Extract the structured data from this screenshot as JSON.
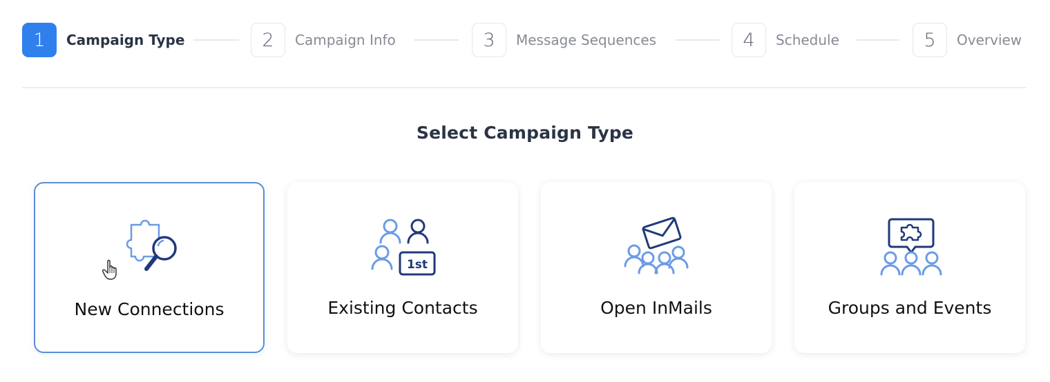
{
  "stepper": {
    "steps": [
      {
        "number": "1",
        "label": "Campaign Type",
        "active": true
      },
      {
        "number": "2",
        "label": "Campaign Info",
        "active": false
      },
      {
        "number": "3",
        "label": "Message Sequences",
        "active": false
      },
      {
        "number": "4",
        "label": "Schedule",
        "active": false
      },
      {
        "number": "5",
        "label": "Overview",
        "active": false
      }
    ]
  },
  "main": {
    "title": "Select Campaign Type",
    "cards": [
      {
        "label": "New Connections",
        "icon": "puzzle-search-icon",
        "selected": true
      },
      {
        "label": "Existing Contacts",
        "icon": "first-degree-contacts-icon",
        "selected": false
      },
      {
        "label": "Open InMails",
        "icon": "group-envelope-icon",
        "selected": false
      },
      {
        "label": "Groups and Events",
        "icon": "group-chat-puzzle-icon",
        "selected": false
      }
    ]
  },
  "colors": {
    "accent": "#2f80ed",
    "icon_dark": "#1f3a7a",
    "icon_light": "#6b9be6",
    "text_dark": "#2b3445",
    "text_muted": "#868a94"
  }
}
